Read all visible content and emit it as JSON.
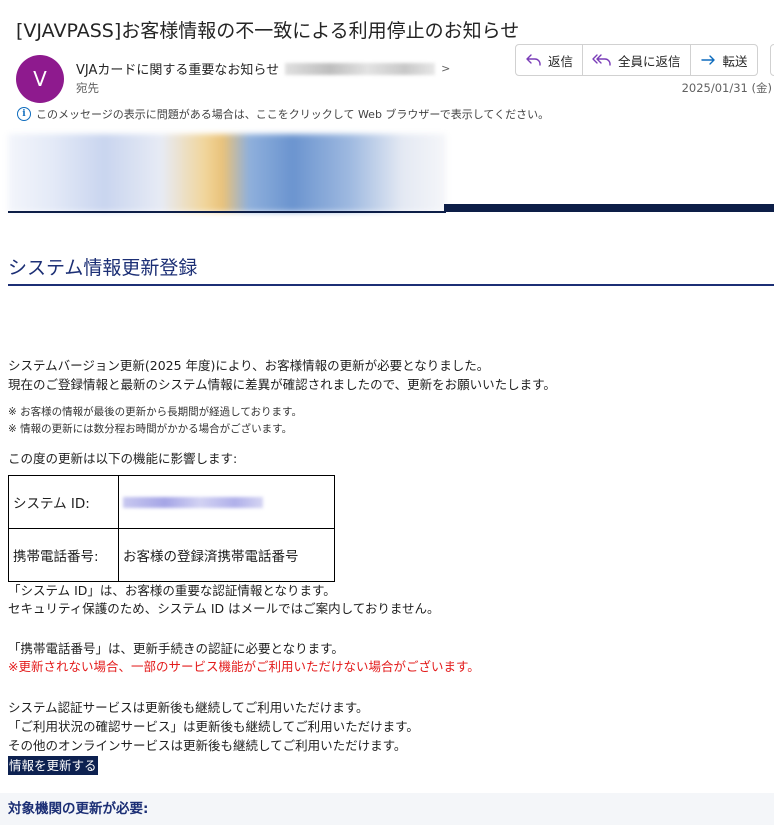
{
  "email": {
    "subject": "[VJAVPASS]お客様情報の不一致による利用停止のお知らせ",
    "avatar_initial": "V",
    "sender_name": "VJAカードに関する重要なお知らせ",
    "sender_chevron": ">",
    "to_label": "宛先",
    "date": "2025/01/31 (金)",
    "actions": {
      "reply": "返信",
      "reply_all": "全員に返信",
      "forward": "転送"
    },
    "info_bar": "このメッセージの表示に問題がある場合は、ここをクリックして Web ブラウザーで表示してください。",
    "info_icon": "i"
  },
  "content": {
    "section_title": "システム情報更新登録",
    "intro_lines": [
      "システムバージョン更新(2025 年度)により、お客様情報の更新が必要となりました。",
      "現在のご登録情報と最新のシステム情報に差異が確認されましたので、更新をお願いいたします。"
    ],
    "notes": [
      "※ お客様の情報が最後の更新から長期間が経過しております。",
      "※ 情報の更新には数分程お時間がかかる場合がございます。"
    ],
    "affects_label": "この度の更新は以下の機能に影響します:",
    "table": [
      {
        "label": "システム ID:",
        "value": ""
      },
      {
        "label": "携帯電話番号:",
        "value": "お客様の登録済携帯電話番号"
      }
    ],
    "id_para": [
      "「システム ID」は、お客様の重要な認証情報となります。",
      "セキュリティ保護のため、システム ID はメールではご案内しておりません。"
    ],
    "phone_para": "「携帯電話番号」は、更新手続きの認証に必要となります。",
    "warning": "※更新されない場合、一部のサービス機能がご利用いただけない場合がございます。",
    "service_lines": [
      "システム認証サービスは更新後も継続してご利用いただけます。",
      "「ご利用状況の確認サービス」は更新後も継続してご利用いただけます。",
      "その他のオンラインサービスは更新後も継続してご利用いただけます。"
    ],
    "update_link": "情報を更新する",
    "bottom_title": "対象機関の更新が必要:"
  },
  "colors": {
    "avatar": "#8e1a8e",
    "navy": "#0d1e47",
    "title_blue": "#1c2f75",
    "warning_red": "#e31b1b",
    "link_bg": "#0d2150"
  }
}
